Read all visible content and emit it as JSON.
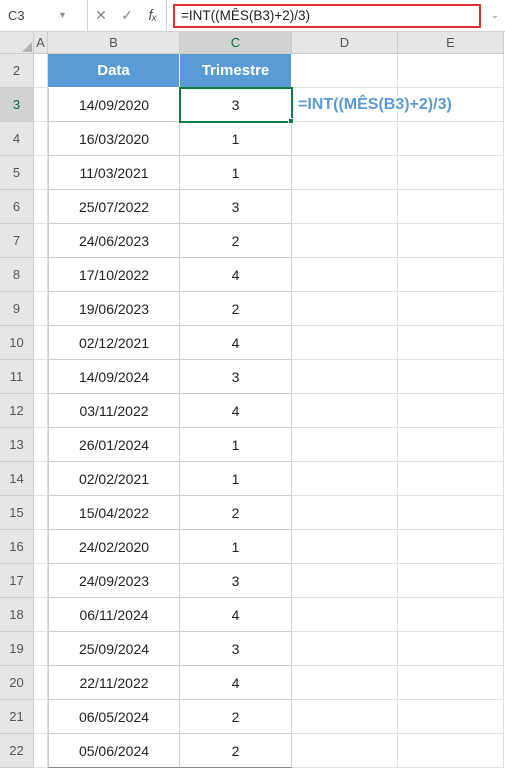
{
  "formula_bar": {
    "name_box": "C3",
    "cancel_glyph": "✕",
    "enter_glyph": "✓",
    "fx_f": "f",
    "fx_x": "x",
    "formula": "=INT((MÊS(B3)+2)/3)",
    "chevron": "▾",
    "expand": "⌄"
  },
  "columns": {
    "A": "A",
    "B": "B",
    "C": "C",
    "D": "D",
    "E": "E"
  },
  "headers": {
    "data": "Data",
    "trimestre": "Trimestre"
  },
  "annotation": "=INT((MÊS(B3)+2)/3)",
  "rows": [
    {
      "n": "2",
      "data": "",
      "tri": ""
    },
    {
      "n": "3",
      "data": "14/09/2020",
      "tri": "3"
    },
    {
      "n": "4",
      "data": "16/03/2020",
      "tri": "1"
    },
    {
      "n": "5",
      "data": "11/03/2021",
      "tri": "1"
    },
    {
      "n": "6",
      "data": "25/07/2022",
      "tri": "3"
    },
    {
      "n": "7",
      "data": "24/06/2023",
      "tri": "2"
    },
    {
      "n": "8",
      "data": "17/10/2022",
      "tri": "4"
    },
    {
      "n": "9",
      "data": "19/06/2023",
      "tri": "2"
    },
    {
      "n": "10",
      "data": "02/12/2021",
      "tri": "4"
    },
    {
      "n": "11",
      "data": "14/09/2024",
      "tri": "3"
    },
    {
      "n": "12",
      "data": "03/11/2022",
      "tri": "4"
    },
    {
      "n": "13",
      "data": "26/01/2024",
      "tri": "1"
    },
    {
      "n": "14",
      "data": "02/02/2021",
      "tri": "1"
    },
    {
      "n": "15",
      "data": "15/04/2022",
      "tri": "2"
    },
    {
      "n": "16",
      "data": "24/02/2020",
      "tri": "1"
    },
    {
      "n": "17",
      "data": "24/09/2023",
      "tri": "3"
    },
    {
      "n": "18",
      "data": "06/11/2024",
      "tri": "4"
    },
    {
      "n": "19",
      "data": "25/09/2024",
      "tri": "3"
    },
    {
      "n": "20",
      "data": "22/11/2022",
      "tri": "4"
    },
    {
      "n": "21",
      "data": "06/05/2024",
      "tri": "2"
    },
    {
      "n": "22",
      "data": "05/06/2024",
      "tri": "2"
    }
  ]
}
